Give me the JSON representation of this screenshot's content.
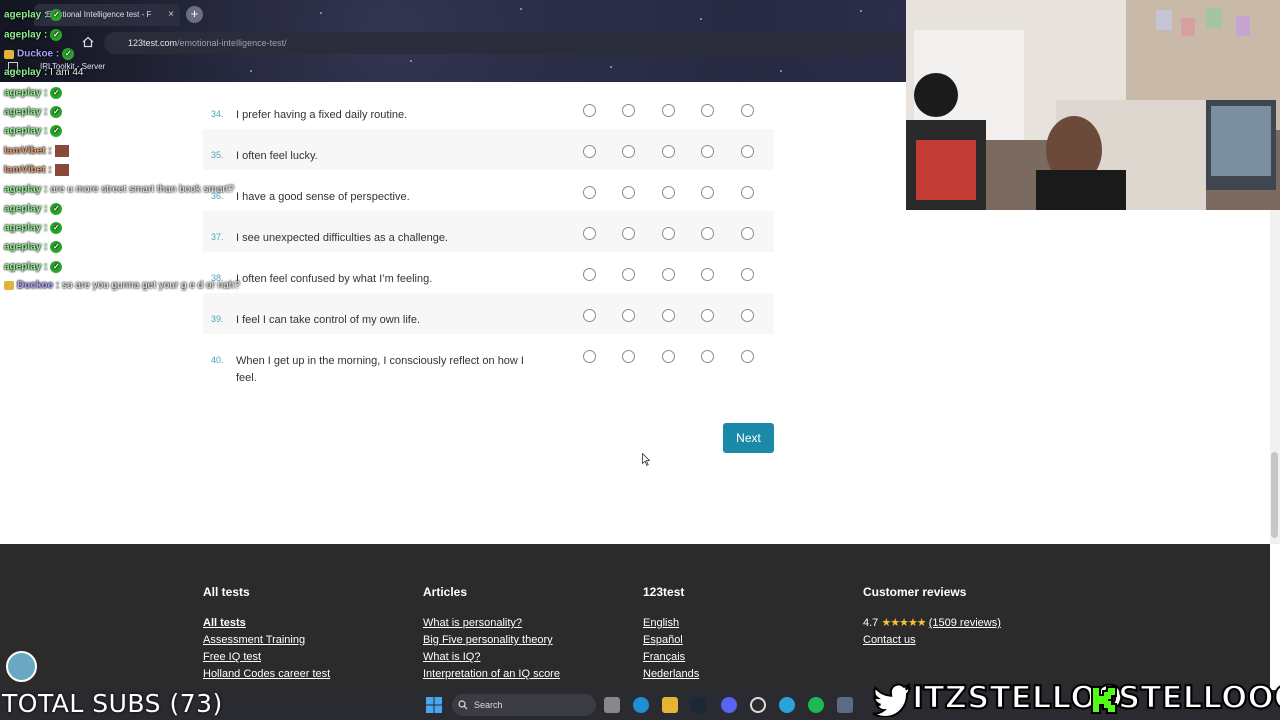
{
  "browser": {
    "tab_title": "Emotional Intelligence test - F",
    "tab_close": "×",
    "new_tab": "+",
    "url_domain": "123test.com",
    "url_path": "/emotional-intelligence-test/",
    "bookmark": "IRLToolkit - Server"
  },
  "questions": [
    {
      "num": "34.",
      "text": "I prefer having a fixed daily routine."
    },
    {
      "num": "35.",
      "text": "I often feel lucky."
    },
    {
      "num": "36.",
      "text": "I have a good sense of perspective."
    },
    {
      "num": "37.",
      "text": "I see unexpected difficulties as a challenge."
    },
    {
      "num": "38.",
      "text": "I often feel confused by what I’m feeling."
    },
    {
      "num": "39.",
      "text": "I feel I can take control of my own life."
    },
    {
      "num": "40.",
      "text": "When I get up in the morning, I consciously reflect on how I feel."
    }
  ],
  "next_button": "Next",
  "footer": {
    "col1": {
      "heading": "All tests",
      "links": [
        "All tests",
        "Assessment Training",
        "Free IQ test",
        "Holland Codes career test"
      ]
    },
    "col2": {
      "heading": "Articles",
      "links": [
        "What is personality?",
        "Big Five personality theory",
        "What is IQ?",
        "Interpretation of an IQ score"
      ]
    },
    "col3": {
      "heading": "123test",
      "links": [
        "English",
        "Español",
        "Français",
        "Nederlands"
      ]
    },
    "col4": {
      "heading": "Customer reviews",
      "rating": "4.7",
      "stars": "★★★★★",
      "reviews": "(1509 reviews)",
      "contact": "Contact us"
    }
  },
  "chat": [
    {
      "user": "ageplay",
      "sep": " :",
      "msg": "",
      "color": "green",
      "badge": "green"
    },
    {
      "user": "ageplay",
      "sep": " :",
      "msg": "",
      "color": "green",
      "badge": "green"
    },
    {
      "user": "Duckoe",
      "sep": " :",
      "msg": "",
      "color": "purple",
      "badge": "green",
      "crown": true
    },
    {
      "user": "ageplay",
      "sep": " :",
      "msg": " I am 44",
      "color": "green"
    },
    {
      "user": "ageplay",
      "sep": " :",
      "msg": "",
      "color": "green",
      "badge": "green"
    },
    {
      "user": "ageplay",
      "sep": " :",
      "msg": "",
      "color": "green",
      "badge": "green"
    },
    {
      "user": "ageplay",
      "sep": " :",
      "msg": "",
      "color": "green",
      "badge": "green"
    },
    {
      "user": "IamVibet",
      "sep": " :",
      "msg": "",
      "color": "brown",
      "badge": "brown"
    },
    {
      "user": "IamVibet",
      "sep": " :",
      "msg": "",
      "color": "brown",
      "badge": "brown"
    },
    {
      "user": "ageplay",
      "sep": " :",
      "msg": " are u more street smart than book smart?",
      "color": "green"
    },
    {
      "user": "ageplay",
      "sep": " :",
      "msg": "",
      "color": "green",
      "badge": "green"
    },
    {
      "user": "ageplay",
      "sep": " :",
      "msg": "",
      "color": "green",
      "badge": "green"
    },
    {
      "user": "ageplay",
      "sep": " :",
      "msg": "",
      "color": "green",
      "badge": "green"
    },
    {
      "user": "ageplay",
      "sep": " :",
      "msg": "",
      "color": "green",
      "badge": "green"
    },
    {
      "user": "Duckoe",
      "sep": " :",
      "msg": " so are you gunna get your g e d or nah?",
      "color": "purple",
      "crown": true
    }
  ],
  "stream": {
    "total_subs": "TOTAL SUBS (73)",
    "twitter_handle": "ITZSTELLOO",
    "kick_handle": "STELLOOO"
  },
  "taskbar": {
    "search": "Search"
  }
}
